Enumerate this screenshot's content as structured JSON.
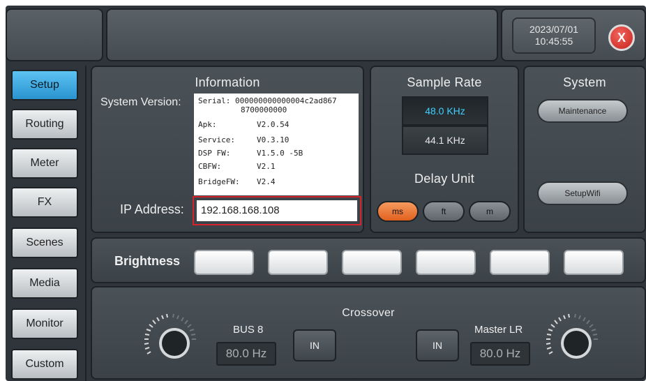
{
  "header": {
    "date": "2023/07/01",
    "time": "10:45:55",
    "close_label": "X"
  },
  "nav": {
    "items": [
      {
        "label": "Setup",
        "active": true
      },
      {
        "label": "Routing",
        "active": false
      },
      {
        "label": "Meter",
        "active": false
      },
      {
        "label": "FX",
        "active": false
      },
      {
        "label": "Scenes",
        "active": false
      },
      {
        "label": "Media",
        "active": false
      },
      {
        "label": "Monitor",
        "active": false
      },
      {
        "label": "Custom",
        "active": false
      }
    ]
  },
  "information": {
    "title": "Information",
    "system_version_label": "System Version:",
    "serial_label": "Serial:",
    "serial_value_1": "000000000000004c2ad867",
    "serial_value_2": "8700000000",
    "apk_label": "Apk:",
    "apk_value": "V2.0.54",
    "service_label": "Service:",
    "service_value": "V0.3.10",
    "dsp_label": "DSP FW:",
    "dsp_value": "V1.5.0 -5B",
    "cbfw_label": "CBFW:",
    "cbfw_value": "V2.1",
    "bridge_label": "BridgeFW:",
    "bridge_value": "V2.4",
    "ip_label": "IP Address:",
    "ip_value": "192.168.168.108"
  },
  "sample_rate": {
    "title": "Sample Rate",
    "options": [
      "48.0 KHz",
      "44.1 KHz"
    ],
    "selected": "48.0 KHz"
  },
  "delay_unit": {
    "title": "Delay Unit",
    "options": [
      "ms",
      "ft",
      "m"
    ],
    "selected": "ms"
  },
  "system": {
    "title": "System",
    "maintenance_label": "Maintenance",
    "wifi_label": "SetupWifi"
  },
  "brightness": {
    "label": "Brightness"
  },
  "crossover": {
    "title": "Crossover",
    "left_label": "BUS 8",
    "left_freq": "80.0 Hz",
    "left_in": "IN",
    "right_label": "Master LR",
    "right_freq": "80.0 Hz",
    "right_in": "IN"
  },
  "colors": {
    "accent_blue": "#2a93cf",
    "accent_orange": "#e1611f",
    "selected_text": "#3fd0ff",
    "highlight_red": "#d4232a"
  }
}
